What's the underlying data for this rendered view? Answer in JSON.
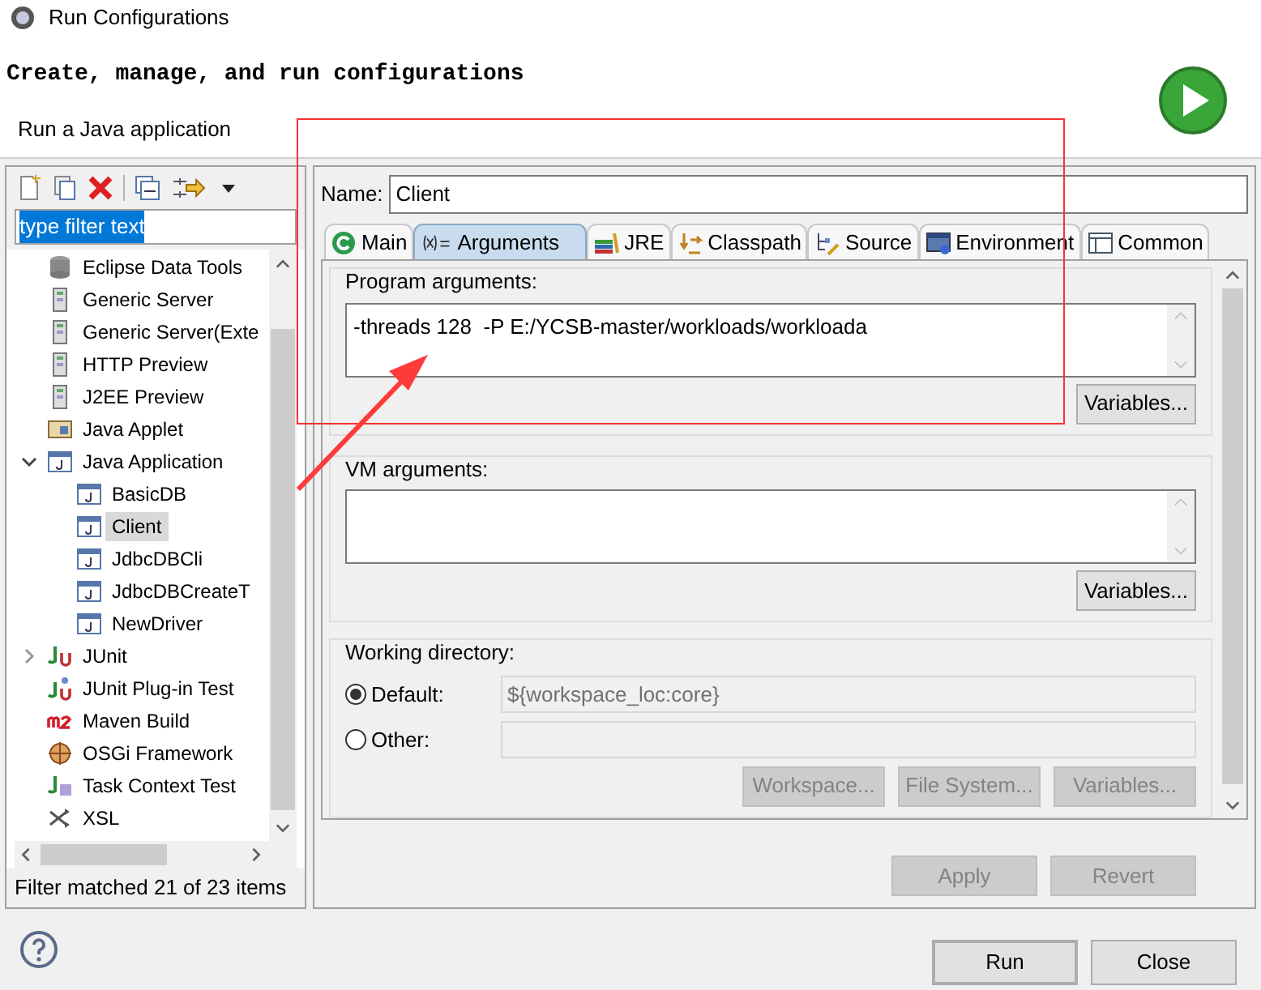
{
  "window": {
    "title": "Run Configurations"
  },
  "header": {
    "title": "Create, manage, and run configurations",
    "subtitle": "Run a Java application"
  },
  "filter": {
    "value": "type filter text"
  },
  "tree": [
    {
      "label": "Eclipse Data Tools",
      "kind": "database",
      "selected": false
    },
    {
      "label": "Generic Server",
      "kind": "server",
      "selected": false
    },
    {
      "label": "Generic Server(Exte",
      "kind": "server",
      "selected": false
    },
    {
      "label": "HTTP Preview",
      "kind": "server",
      "selected": false
    },
    {
      "label": "J2EE Preview",
      "kind": "server",
      "selected": false
    },
    {
      "label": "Java Applet",
      "kind": "applet",
      "selected": false
    },
    {
      "label": "Java Application",
      "kind": "java",
      "selected": false,
      "expanded": true,
      "children": [
        {
          "label": "BasicDB",
          "kind": "java",
          "selected": false
        },
        {
          "label": "Client",
          "kind": "java",
          "selected": true
        },
        {
          "label": "JdbcDBCli",
          "kind": "java",
          "selected": false
        },
        {
          "label": "JdbcDBCreateT",
          "kind": "java",
          "selected": false
        },
        {
          "label": "NewDriver",
          "kind": "java",
          "selected": false
        }
      ]
    },
    {
      "label": "JUnit",
      "kind": "junit",
      "selected": false,
      "expanded": false
    },
    {
      "label": "JUnit Plug-in Test",
      "kind": "plugin",
      "selected": false
    },
    {
      "label": "Maven Build",
      "kind": "maven",
      "selected": false
    },
    {
      "label": "OSGi Framework",
      "kind": "osgi",
      "selected": false
    },
    {
      "label": "Task Context Test",
      "kind": "task",
      "selected": false
    },
    {
      "label": "XSL",
      "kind": "xsl",
      "selected": false
    }
  ],
  "filter_status": "Filter matched 21 of 23 items",
  "name": {
    "label": "Name:",
    "value": "Client"
  },
  "tabs": [
    {
      "label": "Main",
      "kind": "main",
      "selected": false
    },
    {
      "label": "Arguments",
      "kind": "args",
      "selected": true
    },
    {
      "label": "JRE",
      "kind": "jre",
      "selected": false
    },
    {
      "label": "Classpath",
      "kind": "classpath",
      "selected": false
    },
    {
      "label": "Source",
      "kind": "source",
      "selected": false
    },
    {
      "label": "Environment",
      "kind": "env",
      "selected": false
    },
    {
      "label": "Common",
      "kind": "common",
      "selected": false
    }
  ],
  "program_arguments": {
    "label": "Program arguments:",
    "value": "-threads 128  -P E:/YCSB-master/workloads/workloada",
    "button": "Variables..."
  },
  "vm_arguments": {
    "label": "VM arguments:",
    "button": "Variables..."
  },
  "working_directory": {
    "label": "Working directory:",
    "options": [
      {
        "label": "Default:",
        "selected": true,
        "value": "${workspace_loc:core}"
      },
      {
        "label": "Other:",
        "selected": false
      }
    ],
    "buttons": [
      {
        "label": "Workspace...",
        "disabled": true
      },
      {
        "label": "File System...",
        "disabled": true
      },
      {
        "label": "Variables...",
        "disabled": true
      }
    ]
  },
  "form_buttons": [
    {
      "label": "Apply",
      "disabled": true
    },
    {
      "label": "Revert",
      "disabled": true
    }
  ],
  "dialog_buttons": [
    {
      "label": "Run",
      "default": true
    },
    {
      "label": "Close",
      "default": false
    }
  ]
}
